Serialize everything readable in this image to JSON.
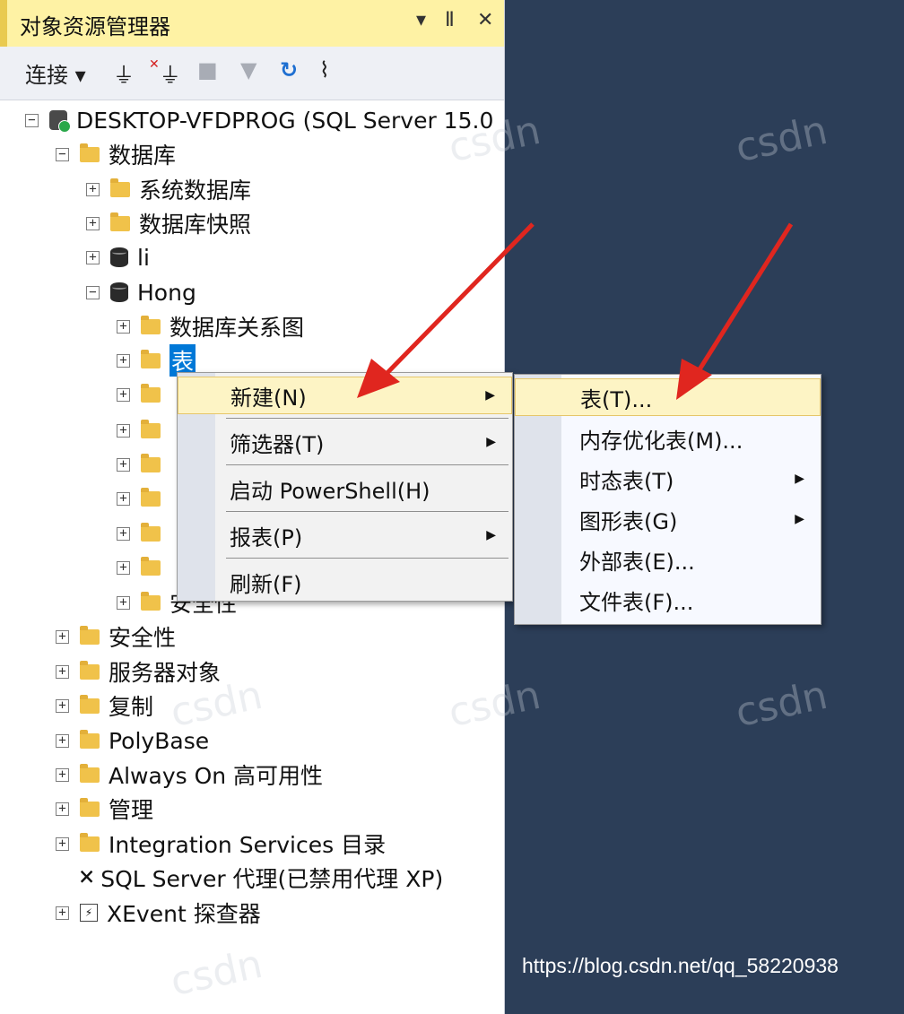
{
  "panel": {
    "title": "对象资源管理器",
    "header_buttons": [
      "▾",
      "Ⅱ",
      "✕"
    ]
  },
  "toolbar": {
    "connect_label": "连接 ▾"
  },
  "tree": {
    "server": "DESKTOP-VFDPROG (SQL Server 15.0",
    "databases": "数据库",
    "system_databases": "系统数据库",
    "db_snapshots": "数据库快照",
    "db_li": "li",
    "db_hong": "Hong",
    "hong_children": {
      "diagrams": "数据库关系图",
      "tables": "表",
      "security": "安全性"
    },
    "security": "安全性",
    "server_objects": "服务器对象",
    "replication": "复制",
    "polybase": "PolyBase",
    "always_on": "Always On 高可用性",
    "management": "管理",
    "integration_services": "Integration Services 目录",
    "sql_agent": "SQL Server 代理(已禁用代理 XP)",
    "xevent": "XEvent 探查器"
  },
  "context_menu": {
    "items": [
      "新建(N)",
      "筛选器(T)",
      "启动 PowerShell(H)",
      "报表(P)",
      "刷新(F)"
    ]
  },
  "submenu": {
    "items": [
      "表(T)...",
      "内存优化表(M)...",
      "时态表(T)",
      "图形表(G)",
      "外部表(E)...",
      "文件表(F)..."
    ]
  },
  "watermark_text": "csdn",
  "footer_url": "https://blog.csdn.net/qq_58220938",
  "colors": {
    "background": "#2c3e58",
    "header": "#fef2a4",
    "highlight": "#fdf4c5",
    "arrow": "#e0261f",
    "selection": "#0078d7"
  }
}
